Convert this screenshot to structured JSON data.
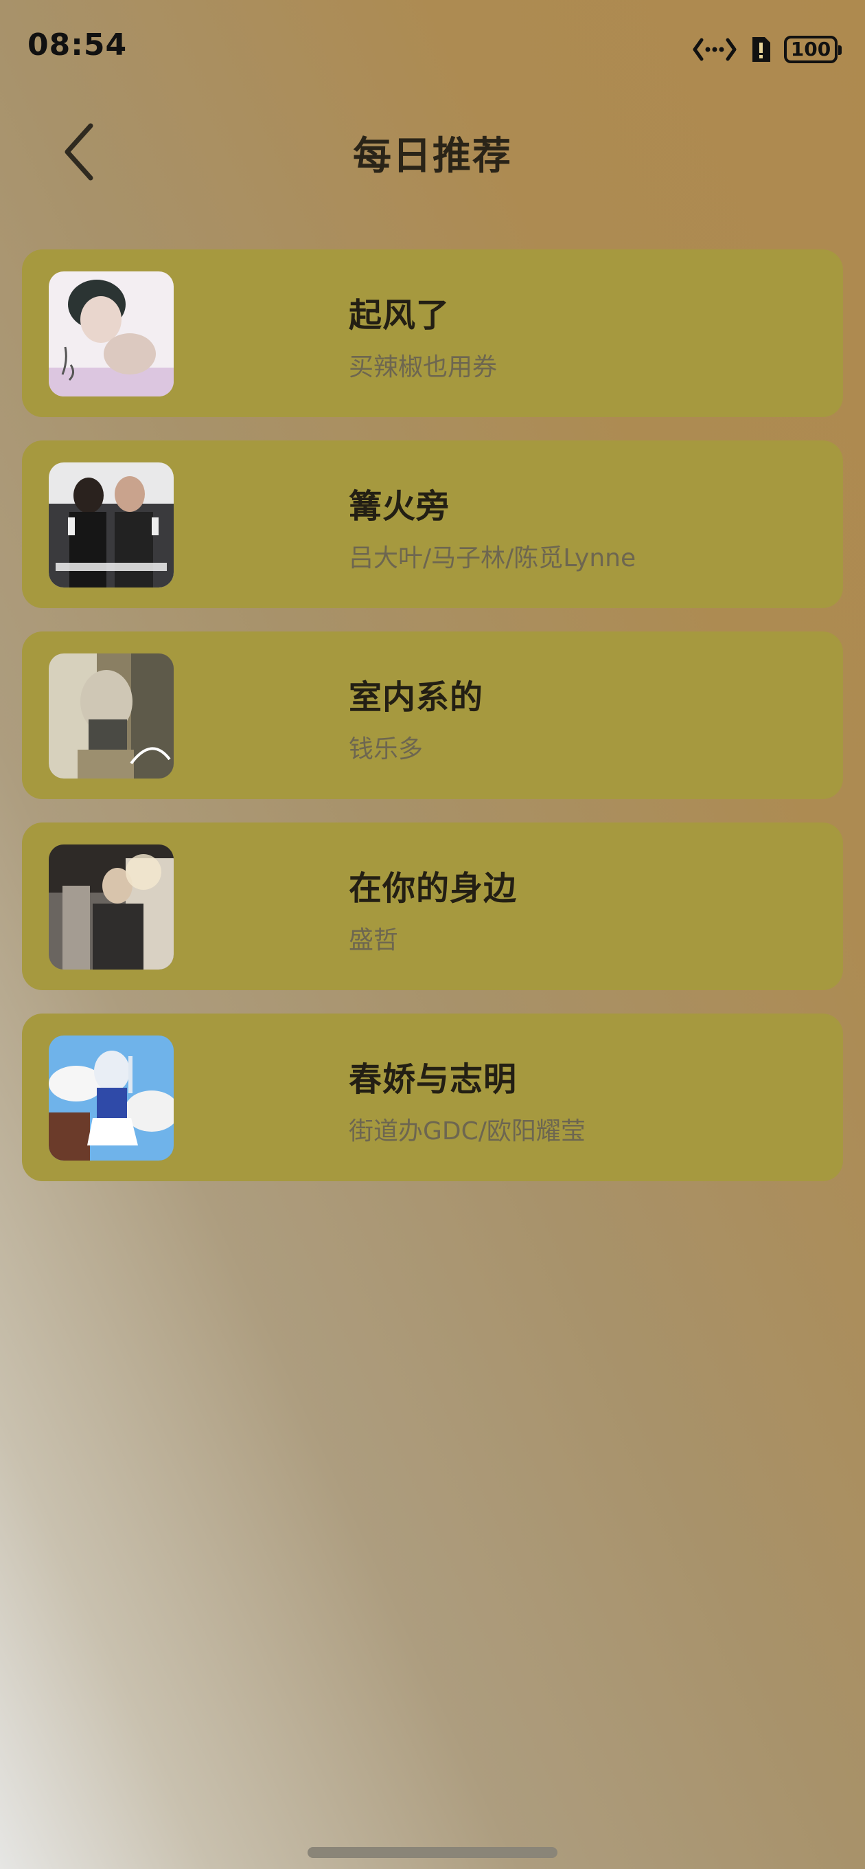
{
  "status_bar": {
    "time": "08:54",
    "battery": "100",
    "icons": [
      "data-transfer-icon",
      "sim-alert-icon",
      "battery-icon"
    ]
  },
  "header": {
    "title": "每日推荐",
    "back_icon": "chevron-left-icon"
  },
  "songs": [
    {
      "title": "起风了",
      "artist": "买辣椒也用券"
    },
    {
      "title": "篝火旁",
      "artist": "吕大叶/马子林/陈觅Lynne"
    },
    {
      "title": "室内系的",
      "artist": "钱乐多"
    },
    {
      "title": "在你的身边",
      "artist": "盛哲"
    },
    {
      "title": "春娇与志明",
      "artist": "街道办GDC/欧阳耀莹"
    }
  ],
  "colors": {
    "card": "#a6993f",
    "title_text": "#231f14",
    "artist_text": "#6d6650"
  }
}
